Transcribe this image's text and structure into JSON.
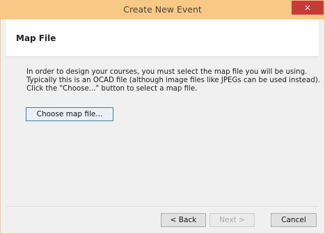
{
  "window": {
    "title": "Create New Event",
    "close_glyph": "✕"
  },
  "header": {
    "heading": "Map File"
  },
  "content": {
    "instructions": [
      "In order to design your courses, you must select the map file you will be using.",
      "Typically this is an OCAD file (although image files like JPEGs can be used instead).",
      "Click the \"Choose...\" button to select a map file."
    ],
    "choose_button_label": "Choose map file..."
  },
  "footer": {
    "back_label": "< Back",
    "next_label": "Next >",
    "next_enabled": false,
    "cancel_label": "Cancel"
  },
  "colors": {
    "titlebar": "#f8c985",
    "close_button": "#c73a3a",
    "choose_button_border": "#3c7fb1"
  },
  "icons": {
    "close": "close-icon"
  }
}
